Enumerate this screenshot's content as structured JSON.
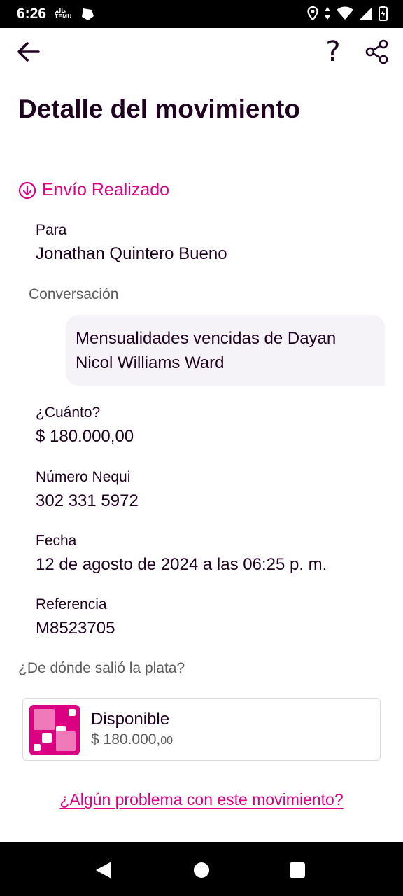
{
  "status_bar": {
    "time": "6:26",
    "temu_top": "عالم",
    "temu_bottom": "TEMU"
  },
  "header": {
    "back_icon": "arrow-left-icon",
    "help": "?",
    "share_icon": "share-icon"
  },
  "page": {
    "title": "Detalle del movimiento"
  },
  "status": {
    "icon": "arrow-down-circle-icon",
    "text": "Envío Realizado"
  },
  "details": {
    "para_label": "Para",
    "para_value": "Jonathan Quintero Bueno",
    "conversation_label": "Conversación",
    "conversation_message": "Mensualidades vencidas de Dayan Nicol Williams Ward",
    "amount_label": "¿Cuánto?",
    "amount_value": "$ 180.000,00",
    "number_label": "Número Nequi",
    "number_value": "302 331 5972",
    "date_label": "Fecha",
    "date_value": "12 de agosto de 2024 a las 06:25 p. m.",
    "reference_label": "Referencia",
    "reference_value": "M8523705"
  },
  "source": {
    "label": "¿De dónde salió la plata?",
    "account_name": "Disponible",
    "account_amount_int": "$ 180.000,",
    "account_amount_dec": "00"
  },
  "problem_link": "¿Algún problema con este movimiento?",
  "colors": {
    "accent": "#da0081",
    "text": "#200020",
    "muted": "#5b5b5b",
    "bubble": "#f5f3f8"
  }
}
